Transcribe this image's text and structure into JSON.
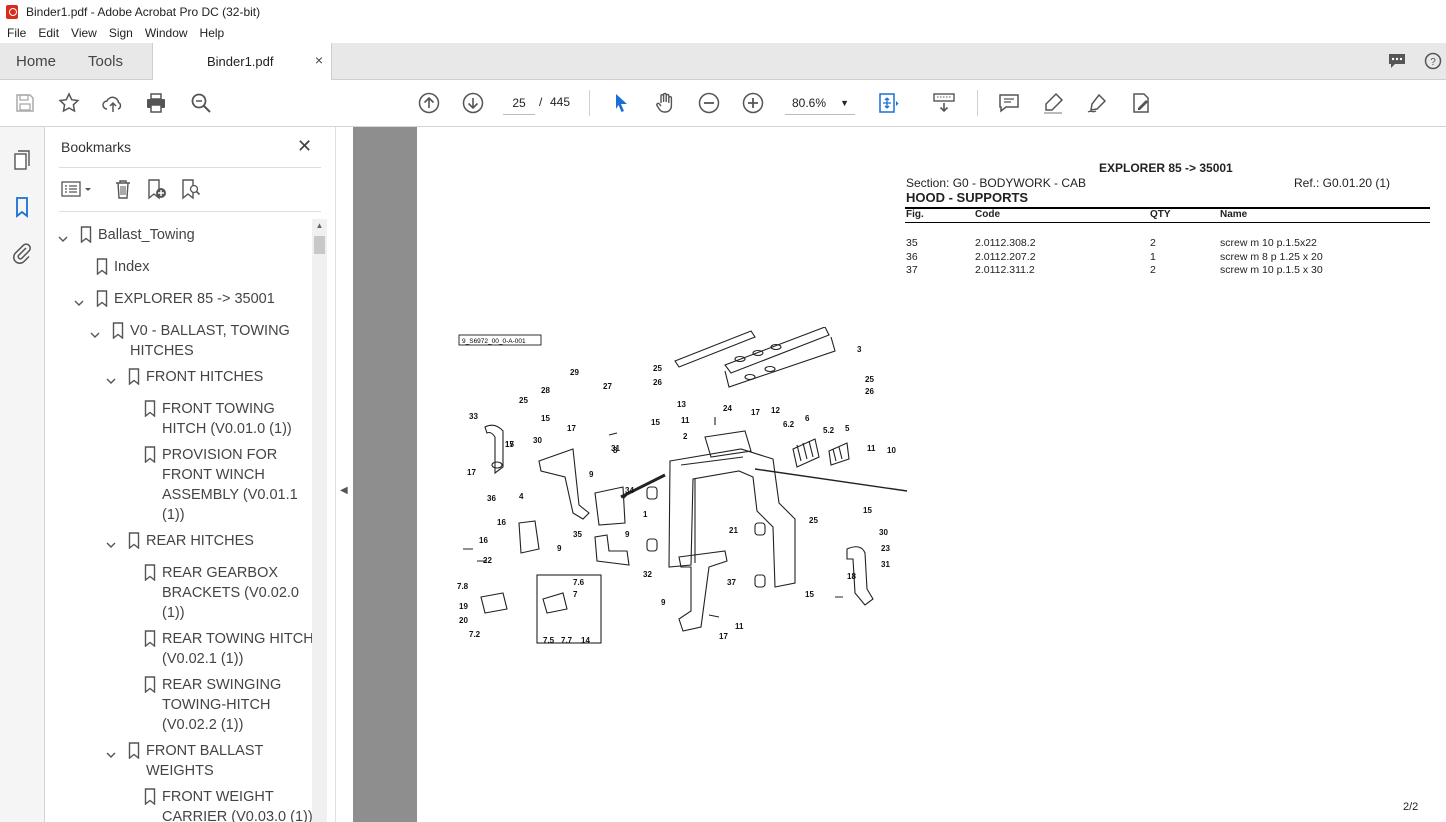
{
  "window": {
    "title": "Binder1.pdf - Adobe Acrobat Pro DC (32-bit)"
  },
  "menu": [
    "File",
    "Edit",
    "View",
    "Sign",
    "Window",
    "Help"
  ],
  "tabs": {
    "home": "Home",
    "tools": "Tools",
    "document": "Binder1.pdf",
    "close": "×"
  },
  "toolbar": {
    "page_current": "25",
    "page_sep": "/",
    "page_total": "445",
    "zoom": "80.6%"
  },
  "bookmarks": {
    "title": "Bookmarks",
    "close": "✕",
    "items": [
      {
        "label": "Ballast_Towing",
        "lines": [
          "Ballast_Towing"
        ]
      },
      {
        "label": "Index",
        "lines": [
          "Index"
        ]
      },
      {
        "label": "EXPLORER 85 -> 35001",
        "lines": [
          "EXPLORER 85 -> 35001"
        ]
      },
      {
        "label": "V0 - BALLAST, TOWING HITCHES",
        "lines": [
          "V0 - BALLAST, TOWING",
          "HITCHES"
        ]
      },
      {
        "label": "FRONT HITCHES",
        "lines": [
          "FRONT HITCHES"
        ]
      },
      {
        "label": "FRONT TOWING HITCH (V0.01.0 (1))",
        "lines": [
          "FRONT TOWING",
          "HITCH (V0.01.0 (1))"
        ]
      },
      {
        "label": "PROVISION FOR FRONT WINCH ASSEMBLY (V0.01.1 (1))",
        "lines": [
          "PROVISION FOR",
          "FRONT WINCH",
          "ASSEMBLY (V0.01.1",
          "(1))"
        ]
      },
      {
        "label": "REAR HITCHES",
        "lines": [
          "REAR HITCHES"
        ]
      },
      {
        "label": "REAR GEARBOX BRACKETS (V0.02.0 (1))",
        "lines": [
          "REAR GEARBOX",
          "BRACKETS (V0.02.0",
          "(1))"
        ]
      },
      {
        "label": "REAR TOWING HITCH (V0.02.1 (1))",
        "lines": [
          "REAR TOWING HITCH",
          "(V0.02.1 (1))"
        ]
      },
      {
        "label": "REAR SWINGING TOWING-HITCH (V0.02.2 (1))",
        "lines": [
          "REAR SWINGING",
          "TOWING-HITCH",
          "(V0.02.2 (1))"
        ]
      },
      {
        "label": "FRONT BALLAST WEIGHTS",
        "lines": [
          "FRONT BALLAST",
          "WEIGHTS"
        ]
      },
      {
        "label": "FRONT WEIGHT CARRIER (V0.03.0 (1))",
        "lines": [
          "FRONT WEIGHT",
          "CARRIER (V0.03.0 (1))"
        ]
      }
    ]
  },
  "document": {
    "model": "EXPLORER 85 -> 35001",
    "section": "Section: G0 - BODYWORK - CAB",
    "ref": "Ref.: G0.01.20 (1)",
    "title": "HOOD - SUPPORTS",
    "columns": {
      "fig": "Fig.",
      "code": "Code",
      "qty": "QTY",
      "name": "Name"
    },
    "parts": [
      {
        "fig": "35",
        "code": "2.0112.308.2",
        "qty": "2",
        "name": "screw m 10 p.1.5x22"
      },
      {
        "fig": "36",
        "code": "2.0112.207.2",
        "qty": "1",
        "name": "screw m 8 p 1.25 x 20"
      },
      {
        "fig": "37",
        "code": "2.0112.311.2",
        "qty": "2",
        "name": "screw m 10 p.1.5 x 30"
      }
    ],
    "drawing_ref": "9_S6972_00_0-A-001",
    "callouts": [
      "25",
      "26",
      "3",
      "25",
      "26",
      "28",
      "29",
      "27",
      "13",
      "24",
      "17",
      "11",
      "2",
      "12",
      "6.2",
      "6",
      "5.2",
      "5",
      "11",
      "10",
      "33",
      "25",
      "15",
      "17",
      "30",
      "17",
      "8",
      "15",
      "31",
      "17",
      "15",
      "36",
      "4",
      "9",
      "34",
      "1",
      "25",
      "15",
      "30",
      "23",
      "16",
      "35",
      "9",
      "9",
      "21",
      "16",
      "22",
      "32",
      "31",
      "18",
      "7.8",
      "7.6",
      "7",
      "19",
      "20",
      "7.2",
      "7.5",
      "7.7",
      "14",
      "9",
      "37",
      "11",
      "17",
      "15"
    ],
    "page_number": "2/2"
  }
}
